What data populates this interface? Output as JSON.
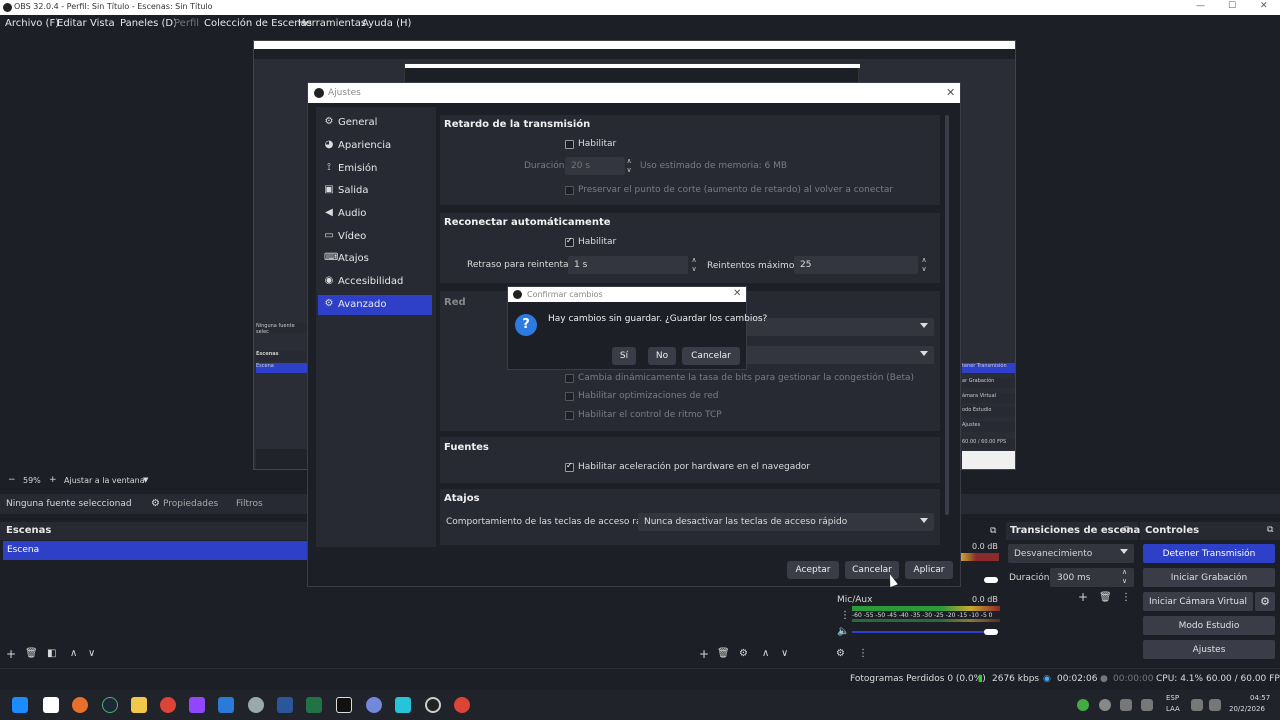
{
  "window": {
    "title": "OBS 32.0.4 - Perfil: Sin Título - Escenas: Sin Título",
    "min": "—",
    "max": "☐",
    "close": "✕"
  },
  "menu": [
    "Archivo (F)",
    "Editar",
    "Vista",
    "Paneles (D)",
    "Perfil",
    "Colección de Escenas",
    "Herramientas",
    "Ayuda (H)"
  ],
  "preview_toolbar": {
    "zoom": "59%",
    "fit": "Ajustar a la ventana",
    "minus": "−",
    "plus": "+"
  },
  "source_bar": {
    "no_source": "Ninguna fuente seleccionad",
    "properties": "Propiedades",
    "filters": "Filtros"
  },
  "scenes": {
    "header": "Escenas",
    "item": "Escena"
  },
  "transitions": {
    "header": "Transiciones de escena",
    "type": "Desvanecimiento",
    "duration_label": "Duración",
    "duration_value": "300 ms"
  },
  "controls": {
    "header": "Controles",
    "stop_stream": "Detener Transmisión",
    "start_record": "Iniciar Grabación",
    "start_vcam": "Iniciar Cámara Virtual",
    "studio_mode": "Modo Estudio",
    "settings": "Ajustes"
  },
  "mixer": {
    "desktop_db": "0.0 dB",
    "mic_label": "Mic/Aux",
    "mic_db": "0.0 dB",
    "scale": "-60 -55 -50 -45 -40 -35 -30 -25 -20 -15 -10 -5 0"
  },
  "status": {
    "dropped": "Fotogramas Perdidos 0 (0.0%)",
    "kbps": "2676 kbps",
    "stream_time": "00:02:06",
    "rec_time": "00:00:00",
    "cpu": "CPU: 4.1%",
    "fps": "60.00 / 60.00 FPS"
  },
  "settings": {
    "title": "Ajustes",
    "nav": [
      "General",
      "Apariencia",
      "Emisión",
      "Salida",
      "Audio",
      "Vídeo",
      "Atajos",
      "Accesibilidad",
      "Avanzado"
    ],
    "nav_icons": [
      "gear-icon",
      "palette-icon",
      "antenna-icon",
      "output-icon",
      "speaker-icon",
      "monitor-icon",
      "keyboard-icon",
      "accessibility-icon",
      "advanced-gear-icon"
    ],
    "delay": {
      "title": "Retardo de la transmisión",
      "enable": "Habilitar",
      "duration_label": "Duración",
      "duration_value": "20 s",
      "memory": "Uso estimado de memoria: 6 MB",
      "preserve": "Preservar el punto de corte (aumento de retardo) al volver a conectar"
    },
    "reconnect": {
      "title": "Reconectar automáticamente",
      "enable": "Habilitar",
      "retry_label": "Retraso para reintentar",
      "retry_value": "1 s",
      "max_label": "Reintentos máximos",
      "max_value": "25"
    },
    "network": {
      "title": "Red",
      "dynamic": "Cambia dinámicamente la tasa de bits para gestionar la congestión (Beta)",
      "optimizations": "Habilitar optimizaciones de red",
      "tcp": "Habilitar el control de ritmo TCP"
    },
    "sources": {
      "title": "Fuentes",
      "hw_accel": "Habilitar aceleración por hardware en el navegador"
    },
    "hotkeys": {
      "title": "Atajos",
      "behavior_label": "Comportamiento de las teclas de acceso rápido",
      "behavior_value": "Nunca desactivar las teclas de acceso rápido"
    },
    "buttons": {
      "accept": "Aceptar",
      "cancel": "Cancelar",
      "apply": "Aplicar"
    }
  },
  "confirm": {
    "title": "Confirmar cambios",
    "message": "Hay cambios sin guardar. ¿Guardar los cambios?",
    "yes": "Sí",
    "no": "No",
    "cancel": "Cancelar"
  },
  "taskbar": {
    "lang1": "ESP",
    "lang2": "LAA",
    "time": "04:57",
    "date": "20/2/2026"
  },
  "nested": {
    "no_source": "Ninguna fuente selec",
    "scenes": "Escenas",
    "scene": "Escena",
    "ctrl1": "tener Transmisión",
    "ctrl2": "ar Grabación",
    "ctrl3": "ámara Virtual",
    "ctrl4": "odo Estudio",
    "ctrl5": "Ajustes",
    "fps": "60.00 / 60.00 FPS"
  }
}
